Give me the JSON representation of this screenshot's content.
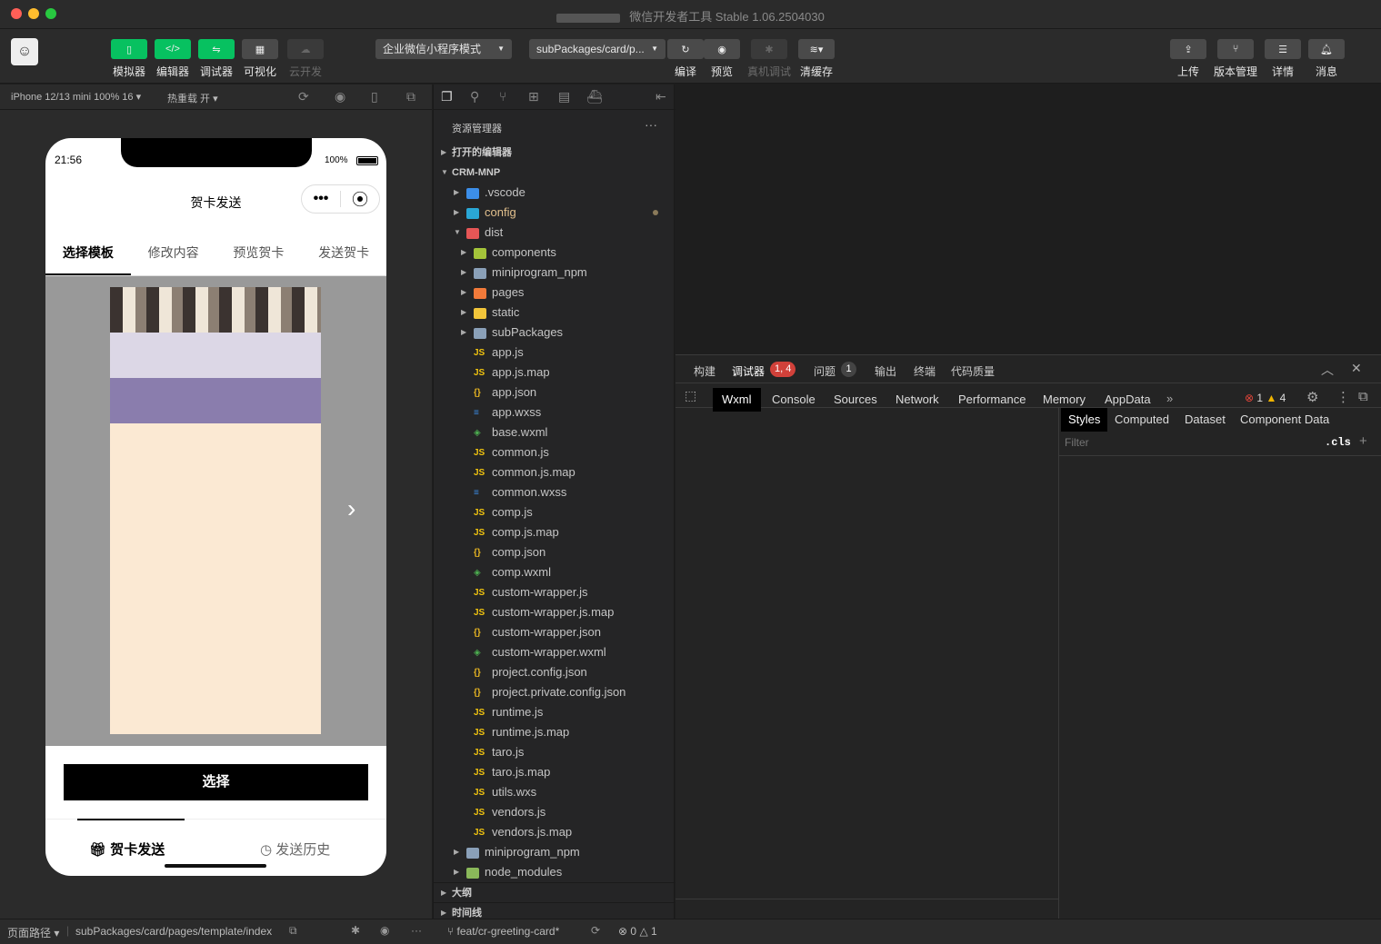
{
  "window": {
    "title": "微信开发者工具 Stable 1.06.2504030"
  },
  "toolbar": {
    "left_buttons": [
      {
        "label": "模拟器",
        "icon": "simulator-icon"
      },
      {
        "label": "编辑器",
        "icon": "code-icon"
      },
      {
        "label": "调试器",
        "icon": "debugger-icon"
      },
      {
        "label": "可视化",
        "icon": "layout-icon"
      },
      {
        "label": "云开发",
        "icon": "cloud-icon"
      }
    ],
    "mode_select": "企业微信小程序模式",
    "path_select": "subPackages/card/p...",
    "mid_buttons": [
      {
        "label": "编译",
        "icon": "refresh-icon"
      },
      {
        "label": "预览",
        "icon": "eye-icon"
      },
      {
        "label": "真机调试",
        "icon": "bug-icon"
      },
      {
        "label": "清缓存",
        "icon": "layers-icon"
      }
    ],
    "right_buttons": [
      {
        "label": "上传",
        "icon": "upload-icon"
      },
      {
        "label": "版本管理",
        "icon": "branch-icon"
      },
      {
        "label": "详情",
        "icon": "menu-icon"
      },
      {
        "label": "消息",
        "icon": "bell-icon"
      }
    ]
  },
  "simulator": {
    "device": "iPhone 12/13 mini 100% 16",
    "hot_reload": "热重载 开",
    "phone": {
      "time": "21:56",
      "battery": "100%",
      "nav_title": "贺卡发送",
      "tabs": [
        "选择模板",
        "修改内容",
        "预览贺卡",
        "发送贺卡"
      ],
      "select_button": "选择",
      "bottom_tabs": [
        "贺卡发送",
        "发送历史"
      ]
    }
  },
  "explorer": {
    "title": "资源管理器",
    "sections": {
      "open_editors": "打开的编辑器",
      "project": "CRM-MNP",
      "outline": "大纲",
      "timeline": "时间线"
    },
    "items": [
      {
        "name": ".vscode",
        "type": "folder",
        "color": "#3c8ee8",
        "depth": 1
      },
      {
        "name": "config",
        "type": "folder",
        "color": "#2aa7d6",
        "depth": 1,
        "modified": true
      },
      {
        "name": "dist",
        "type": "folder-open",
        "color": "#e65656",
        "depth": 1
      },
      {
        "name": "components",
        "type": "folder",
        "color": "#a4c43a",
        "depth": 2
      },
      {
        "name": "miniprogram_npm",
        "type": "folder",
        "color": "#8aa0b8",
        "depth": 2
      },
      {
        "name": "pages",
        "type": "folder",
        "color": "#f27a3a",
        "depth": 2
      },
      {
        "name": "static",
        "type": "folder",
        "color": "#f2c53a",
        "depth": 2
      },
      {
        "name": "subPackages",
        "type": "folder",
        "color": "#8aa0b8",
        "depth": 2
      },
      {
        "name": "app.js",
        "type": "js",
        "depth": 2
      },
      {
        "name": "app.js.map",
        "type": "js",
        "depth": 2
      },
      {
        "name": "app.json",
        "type": "json",
        "depth": 2
      },
      {
        "name": "app.wxss",
        "type": "css",
        "depth": 2
      },
      {
        "name": "base.wxml",
        "type": "wxml",
        "depth": 2
      },
      {
        "name": "common.js",
        "type": "js",
        "depth": 2
      },
      {
        "name": "common.js.map",
        "type": "js",
        "depth": 2
      },
      {
        "name": "common.wxss",
        "type": "css",
        "depth": 2
      },
      {
        "name": "comp.js",
        "type": "js",
        "depth": 2
      },
      {
        "name": "comp.js.map",
        "type": "js",
        "depth": 2
      },
      {
        "name": "comp.json",
        "type": "json",
        "depth": 2
      },
      {
        "name": "comp.wxml",
        "type": "wxml",
        "depth": 2
      },
      {
        "name": "custom-wrapper.js",
        "type": "js",
        "depth": 2
      },
      {
        "name": "custom-wrapper.js.map",
        "type": "js",
        "depth": 2
      },
      {
        "name": "custom-wrapper.json",
        "type": "json",
        "depth": 2
      },
      {
        "name": "custom-wrapper.wxml",
        "type": "wxml",
        "depth": 2
      },
      {
        "name": "project.config.json",
        "type": "json",
        "depth": 2
      },
      {
        "name": "project.private.config.json",
        "type": "json",
        "depth": 2
      },
      {
        "name": "runtime.js",
        "type": "js",
        "depth": 2
      },
      {
        "name": "runtime.js.map",
        "type": "js",
        "depth": 2
      },
      {
        "name": "taro.js",
        "type": "js",
        "depth": 2
      },
      {
        "name": "taro.js.map",
        "type": "js",
        "depth": 2
      },
      {
        "name": "utils.wxs",
        "type": "js",
        "depth": 2
      },
      {
        "name": "vendors.js",
        "type": "js",
        "depth": 2
      },
      {
        "name": "vendors.js.map",
        "type": "js",
        "depth": 2
      },
      {
        "name": "miniprogram_npm",
        "type": "folder",
        "color": "#8aa0b8",
        "depth": 1
      },
      {
        "name": "node_modules",
        "type": "folder",
        "color": "#8ab85a",
        "depth": 1
      }
    ]
  },
  "devtools": {
    "panel_tabs": [
      "构建",
      "调试器",
      "问题",
      "输出",
      "终端",
      "代码质量"
    ],
    "debugger_badge": "1, 4",
    "problems_badge": "1",
    "console_tabs": [
      "Wxml",
      "Console",
      "Sources",
      "Network",
      "Performance",
      "Memory",
      "AppData"
    ],
    "errors": "1",
    "warnings": "4",
    "style_tabs": [
      "Styles",
      "Computed",
      "Dataset",
      "Component Data"
    ],
    "filter_placeholder": "Filter",
    "cls": ".cls"
  },
  "statusbar": {
    "page_path_label": "页面路径",
    "page_path": "subPackages/card/pages/template/index",
    "branch": "feat/cr-greeting-card*",
    "errors": "0",
    "warnings": "1"
  }
}
